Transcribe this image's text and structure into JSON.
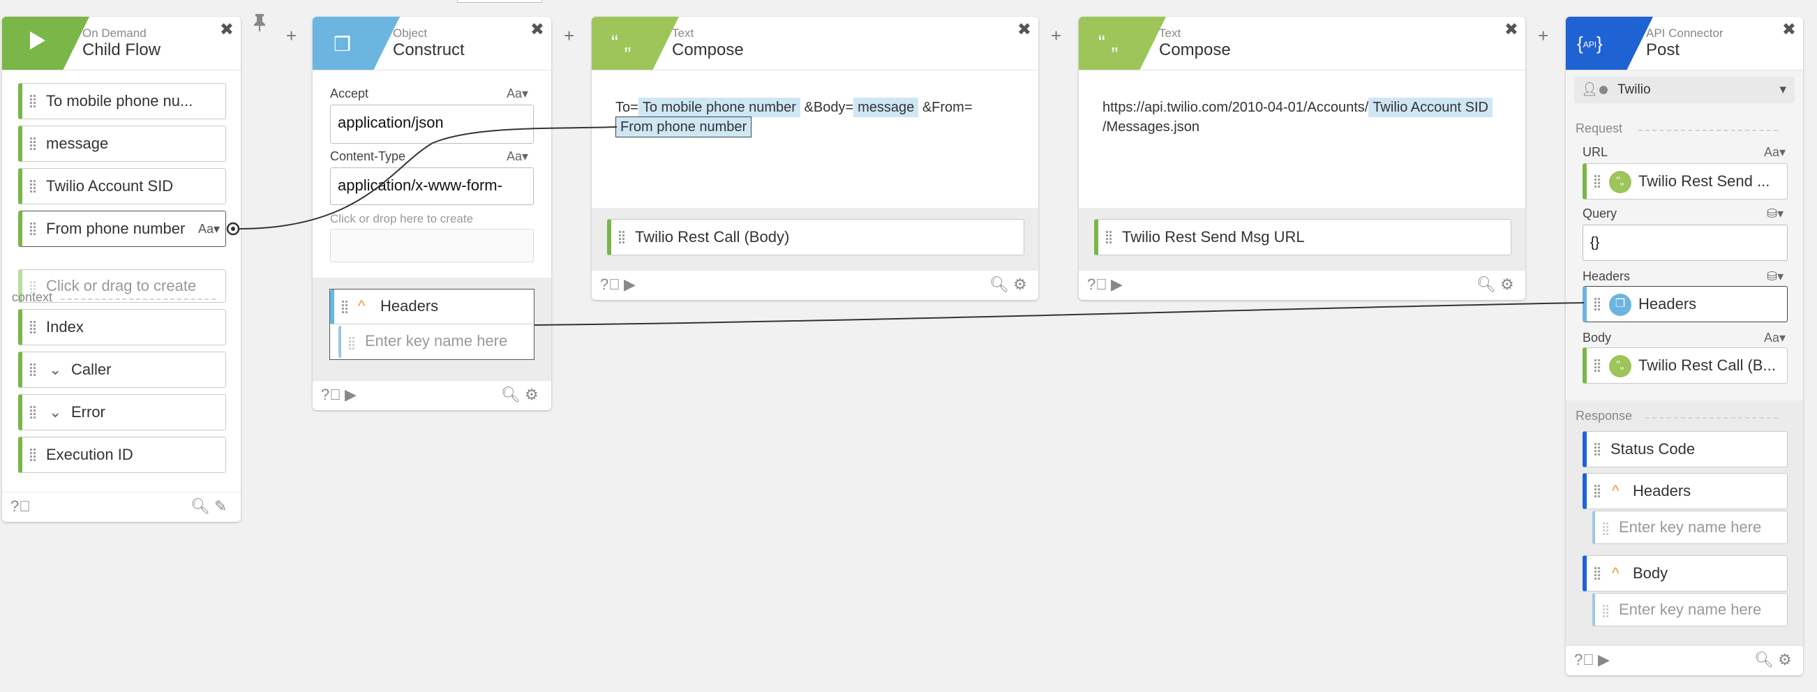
{
  "toolbar": {
    "pin_icon": "pin-icon"
  },
  "colors": {
    "green": "#7ab648",
    "blue": "#6bb5e0",
    "lime": "#9dc55a",
    "api": "#1f62d4"
  },
  "child_flow": {
    "kind": "On Demand",
    "name": "Child Flow",
    "inputs": [
      "To mobile phone nu...",
      "message",
      "Twilio Account SID",
      "From phone number"
    ],
    "from_aa": "Aa▾",
    "create_placeholder": "Click or drag to create",
    "context_label": "context",
    "context_items": [
      "Index",
      "Caller",
      "Error",
      "Execution ID"
    ]
  },
  "construct": {
    "kind": "Object",
    "name": "Construct",
    "accept_label": "Accept",
    "accept_value": "application/json",
    "ctype_label": "Content-Type",
    "ctype_value": "application/x-www-form-",
    "aa": "Aa▾",
    "create_hint": "Click or drop here to create",
    "headers_label": "Headers",
    "key_placeholder": "Enter key name here"
  },
  "compose1": {
    "kind": "Text",
    "name": "Compose",
    "t_to": "To=",
    "tok_to": "To mobile phone number",
    "t_body": "&Body=",
    "tok_msg": "message",
    "t_from": "&From=",
    "tok_from": "From phone number",
    "output": "Twilio Rest Call (Body)"
  },
  "compose2": {
    "kind": "Text",
    "name": "Compose",
    "url_prefix": "https://api.twilio.com/2010-04-01/Accounts/",
    "tok_sid": "Twilio Account SID",
    "url_suffix": "/Messages.json",
    "output": "Twilio Rest Send Msg URL"
  },
  "api": {
    "kind": "API Connector",
    "name": "Post",
    "account": "Twilio",
    "request_label": "Request",
    "url_label": "URL",
    "url_value": "Twilio Rest Send ...",
    "aa": "Aa▾",
    "query_label": "Query",
    "query_value": "{}",
    "headers_label": "Headers",
    "headers_value": "Headers",
    "body_label": "Body",
    "body_value": "Twilio Rest Call (B...",
    "response_label": "Response",
    "status_code": "Status Code",
    "resp_headers": "Headers",
    "resp_body": "Body",
    "key_placeholder": "Enter key name here"
  }
}
